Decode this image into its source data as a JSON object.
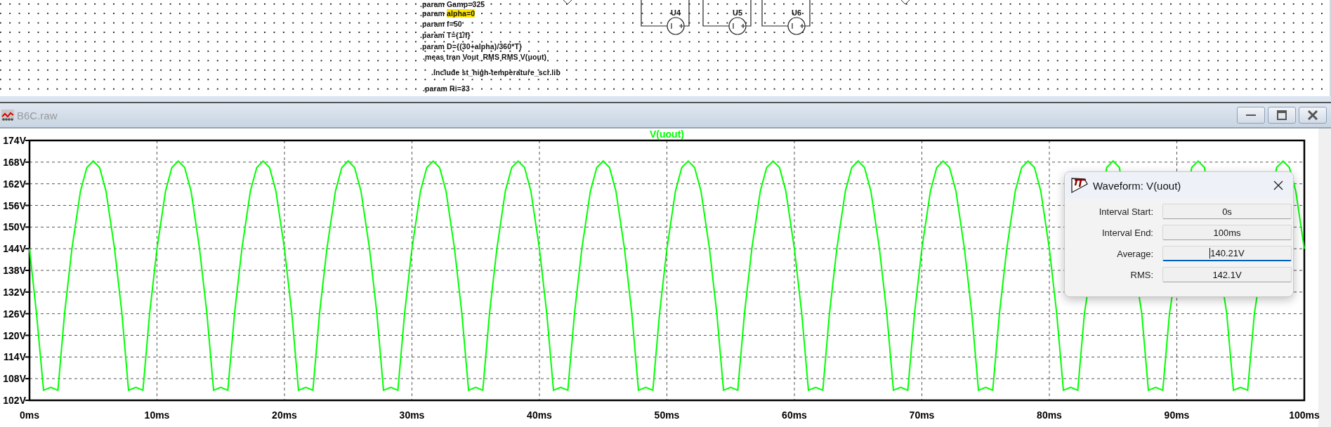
{
  "schematic": {
    "directives": [
      {
        "text": ".param Gamp=325"
      },
      {
        "parts": [
          {
            "text": ".param ",
            "highlighted": false
          },
          {
            "text": "alpha=0",
            "highlighted": true
          }
        ]
      },
      {
        "text": ".param f=50"
      },
      {
        "text": ".param T={1/f}"
      },
      {
        "text": ".param D={(30+alpha)/360*T}"
      },
      {
        "text": ".meas tran Vout_RMS RMS V(uout)"
      },
      {
        "text": ".include st_high-temperature_scr.lib"
      },
      {
        "text": ".param Ri=33"
      }
    ],
    "components": [
      {
        "label": "U4"
      },
      {
        "label": "U5"
      },
      {
        "label": "U6"
      }
    ]
  },
  "waveform_window": {
    "title": "B6C.raw",
    "active": false,
    "plot": {
      "chart_data": {
        "type": "line",
        "grid": true,
        "xlim": [
          0,
          100
        ],
        "ylim": [
          102,
          174
        ],
        "xticks": [
          {
            "value": 0,
            "label": "0ms"
          },
          {
            "value": 10,
            "label": "10ms"
          },
          {
            "value": 20,
            "label": "20ms"
          },
          {
            "value": 30,
            "label": "30ms"
          },
          {
            "value": 40,
            "label": "40ms"
          },
          {
            "value": 50,
            "label": "50ms"
          },
          {
            "value": 60,
            "label": "60ms"
          },
          {
            "value": 70,
            "label": "70ms"
          },
          {
            "value": 80,
            "label": "80ms"
          },
          {
            "value": 90,
            "label": "90ms"
          },
          {
            "value": 100,
            "label": "100ms"
          }
        ],
        "yticks": [
          {
            "value": 174,
            "label": "174V"
          },
          {
            "value": 168,
            "label": "168V"
          },
          {
            "value": 162,
            "label": "162V"
          },
          {
            "value": 156,
            "label": "156V"
          },
          {
            "value": 150,
            "label": "150V"
          },
          {
            "value": 144,
            "label": "144V"
          },
          {
            "value": 138,
            "label": "138V"
          },
          {
            "value": 132,
            "label": "132V"
          },
          {
            "value": 126,
            "label": "126V"
          },
          {
            "value": 120,
            "label": "120V"
          },
          {
            "value": 114,
            "label": "114V"
          },
          {
            "value": 108,
            "label": "108V"
          },
          {
            "value": 102,
            "label": "102V"
          }
        ],
        "x": [
          0,
          0.55,
          1.1,
          1.67,
          2.23,
          2.75,
          3.33,
          4,
          4.5,
          5,
          5.5,
          6,
          6.67,
          7.25,
          7.77,
          8.34,
          8.9,
          9.42,
          10,
          10.67,
          11.17,
          11.67,
          12.17,
          12.67,
          13.34,
          13.92,
          14.44,
          15,
          15.56,
          16.08,
          16.66,
          17.33,
          17.83,
          18.33,
          18.83,
          19.33,
          20,
          20.58,
          21.1,
          21.67,
          22.23,
          22.75,
          23.33,
          24,
          24.5,
          25,
          25.5,
          26,
          26.67,
          27.25,
          27.77,
          28.34,
          28.9,
          29.42,
          30,
          30.67,
          31.17,
          31.67,
          32.17,
          32.67,
          33.34,
          33.92,
          34.44,
          35,
          35.56,
          36.08,
          36.66,
          37.33,
          37.83,
          38.33,
          38.83,
          39.33,
          40,
          40.58,
          41.1,
          41.67,
          42.23,
          42.75,
          43.33,
          44,
          44.5,
          45,
          45.5,
          46,
          46.67,
          47.25,
          47.77,
          48.34,
          48.9,
          49.42,
          50,
          50.67,
          51.17,
          51.67,
          52.17,
          52.67,
          53.34,
          53.92,
          54.44,
          55,
          55.56,
          56.08,
          56.66,
          57.33,
          57.83,
          58.33,
          58.83,
          59.33,
          60,
          60.58,
          61.1,
          61.67,
          62.23,
          62.75,
          63.33,
          64,
          64.5,
          65,
          65.5,
          66,
          66.67,
          67.25,
          67.77,
          68.34,
          68.9,
          69.42,
          70,
          70.67,
          71.17,
          71.67,
          72.17,
          72.67,
          73.34,
          73.92,
          74.44,
          75,
          75.56,
          76.08,
          76.66,
          77.33,
          77.83,
          78.33,
          78.83,
          79.33,
          80,
          80.58,
          81.1,
          81.67,
          82.23,
          82.75,
          84.5,
          85,
          85.5,
          87.25,
          87.77,
          88.34,
          88.9,
          89.42,
          91.17,
          91.67,
          92.17,
          93.92,
          94.44,
          95,
          95.56,
          96.08,
          97.83,
          98.33,
          98.83,
          99.33,
          100
        ],
        "series": [
          {
            "name": "V(uout)",
            "color": "#00ff00",
            "values": [
              144,
              126,
              104.8,
              105.6,
              104.8,
              126,
              144,
              160,
              166.5,
              168.3,
              166.5,
              160,
              144,
              126,
              104.8,
              105.6,
              104.8,
              126,
              144,
              160,
              166.5,
              168.3,
              166.5,
              160,
              144,
              126,
              104.8,
              105.6,
              104.8,
              126,
              144,
              160,
              166.5,
              168.3,
              166.5,
              160,
              144,
              126,
              104.8,
              105.6,
              104.8,
              126,
              144,
              160,
              166.5,
              168.3,
              166.5,
              160,
              144,
              126,
              104.8,
              105.6,
              104.8,
              126,
              144,
              160,
              166.5,
              168.3,
              166.5,
              160,
              144,
              126,
              104.8,
              105.6,
              104.8,
              126,
              144,
              160,
              166.5,
              168.3,
              166.5,
              160,
              144,
              126,
              104.8,
              105.6,
              104.8,
              126,
              144,
              160,
              166.5,
              168.3,
              166.5,
              160,
              144,
              126,
              104.8,
              105.6,
              104.8,
              126,
              144,
              160,
              166.5,
              168.3,
              166.5,
              160,
              144,
              126,
              104.8,
              105.6,
              104.8,
              126,
              144,
              160,
              166.5,
              168.3,
              166.5,
              160,
              144,
              126,
              104.8,
              105.6,
              104.8,
              126,
              144,
              160,
              166.5,
              168.3,
              166.5,
              160,
              144,
              126,
              104.8,
              105.6,
              104.8,
              126,
              144,
              160,
              166.5,
              168.3,
              166.5,
              160,
              144,
              126,
              104.8,
              105.6,
              104.8,
              126,
              144,
              160,
              166.5,
              168.3,
              166.5,
              160,
              144,
              126,
              104.8,
              105.6,
              104.8,
              126,
              166.5,
              168.3,
              166.5,
              126,
              104.8,
              105.6,
              104.8,
              126,
              166.5,
              168.3,
              166.5,
              126,
              104.8,
              105.6,
              104.8,
              126,
              166.5,
              168.3,
              166.5,
              160,
              144
            ]
          }
        ]
      }
    }
  },
  "measure_dialog": {
    "title": "Waveform: V(uout)",
    "fields": [
      {
        "label": "Interval Start:",
        "value": "0s",
        "focused": false
      },
      {
        "label": "Interval End:",
        "value": "100ms",
        "focused": false
      },
      {
        "label": "Average:",
        "value": "140.21V",
        "focused": true
      },
      {
        "label": "RMS:",
        "value": "142.1V",
        "focused": false
      }
    ]
  }
}
